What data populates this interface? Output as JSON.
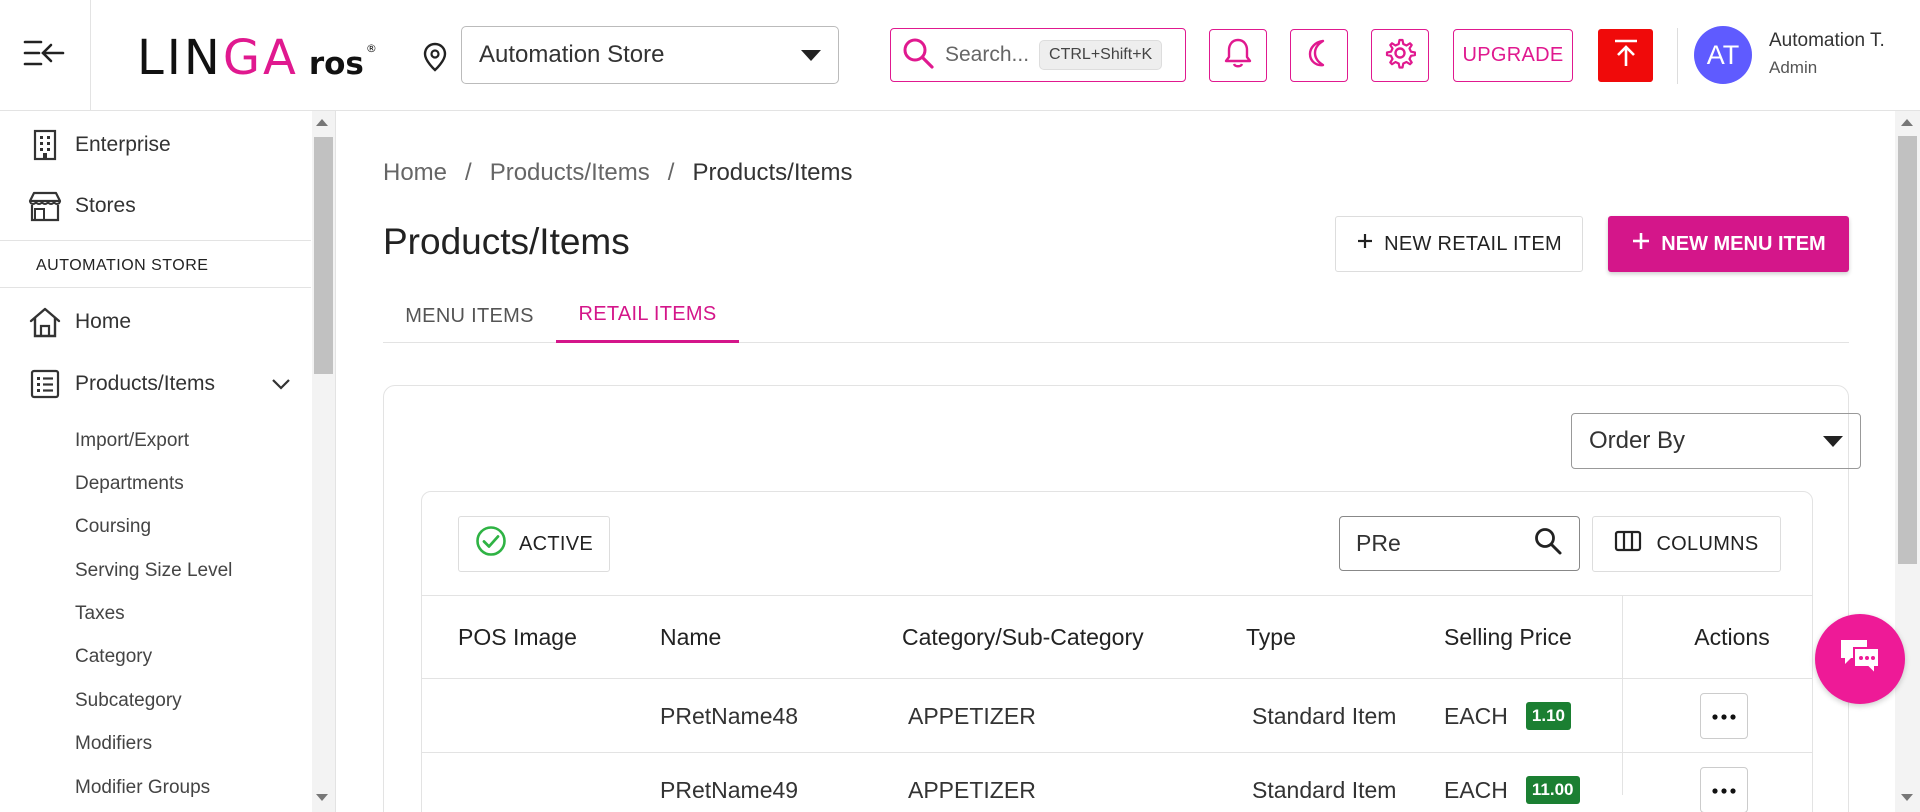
{
  "header": {
    "logo": {
      "part1": "LIN",
      "part2": "GA",
      "part3": "ros",
      "mark": "®"
    },
    "store_select": {
      "value": "Automation Store"
    },
    "search": {
      "placeholder": "Search...",
      "shortcut": "CTRL+Shift+K"
    },
    "upgrade_label": "UPGRADE",
    "user": {
      "initials": "AT",
      "name": "Automation T.",
      "role": "Admin"
    },
    "accent_color": "#e0198f",
    "alert_color": "#f00a0a",
    "avatar_color": "#5f5bff",
    "icons": [
      "menu-collapse-icon",
      "location-pin-icon",
      "search-icon",
      "bell-icon",
      "moon-icon",
      "gear-icon",
      "upload-icon"
    ]
  },
  "sidebar": {
    "top_items": [
      {
        "label": "Enterprise",
        "icon": "building-icon"
      },
      {
        "label": "Stores",
        "icon": "store-icon"
      }
    ],
    "section_label": "AUTOMATION STORE",
    "items": [
      {
        "label": "Home",
        "icon": "home-icon"
      },
      {
        "label": "Products/Items",
        "icon": "list-icon",
        "expanded": true
      }
    ],
    "sub_items": [
      "Import/Export",
      "Departments",
      "Coursing",
      "Serving Size Level",
      "Taxes",
      "Category",
      "Subcategory",
      "Modifiers",
      "Modifier Groups"
    ]
  },
  "main": {
    "breadcrumb": [
      "Home",
      "Products/Items",
      "Products/Items"
    ],
    "breadcrumb_sep": "/",
    "title": "Products/Items",
    "new_retail_label": "NEW RETAIL ITEM",
    "new_menu_label": "NEW MENU ITEM",
    "primary_color": "#d4168a",
    "tabs": [
      {
        "label": "MENU ITEMS",
        "active": false
      },
      {
        "label": "RETAIL ITEMS",
        "active": true
      }
    ],
    "order_by": {
      "value": "Order By"
    },
    "grid": {
      "active_filter_label": "ACTIVE",
      "search_value": "PRe",
      "columns_label": "COLUMNS",
      "columns": [
        "POS Image",
        "Name",
        "Category/Sub-Category",
        "Type",
        "Selling Price",
        "Actions"
      ],
      "rows": [
        {
          "name": "PRetName48",
          "category": "APPETIZER",
          "type": "Standard Item",
          "unit": "EACH",
          "price": "1.10"
        },
        {
          "name": "PRetName49",
          "category": "APPETIZER",
          "type": "Standard Item",
          "unit": "EACH",
          "price": "11.00"
        }
      ],
      "price_badge_color": "#1b7f32"
    }
  },
  "chat": {
    "icon": "chat-icon",
    "color": "#ee1a97"
  }
}
